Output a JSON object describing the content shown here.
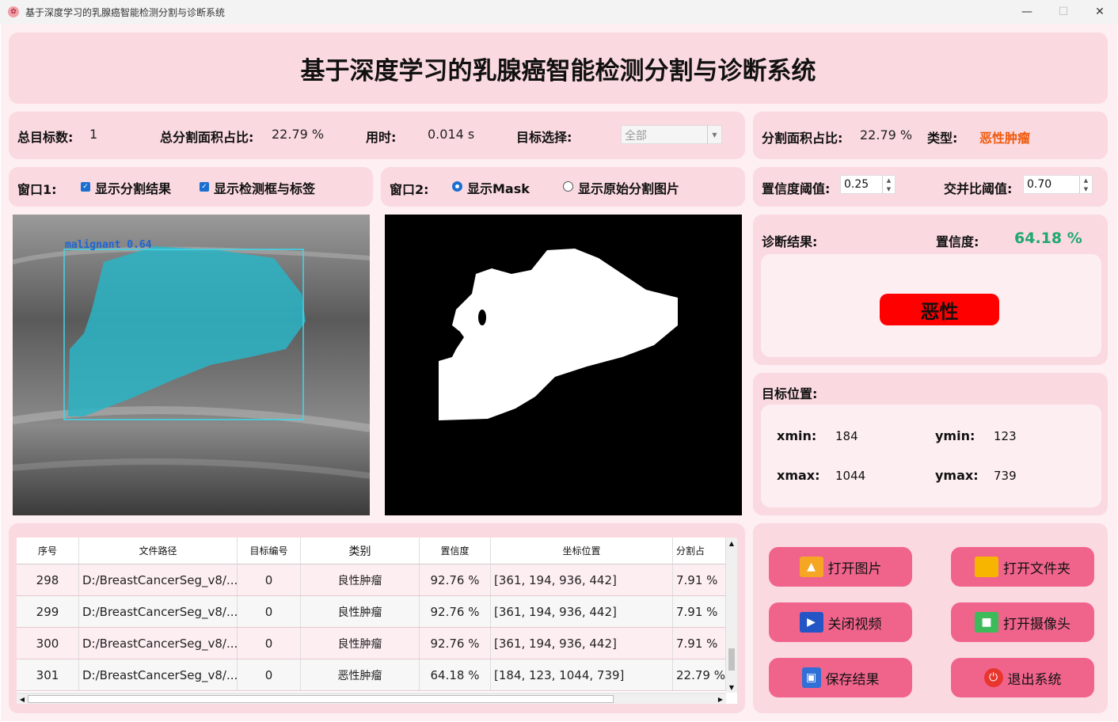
{
  "window": {
    "title": "基于深度学习的乳腺癌智能检测分割与诊断系统",
    "minimize": "—",
    "maximize": "☐",
    "close": "✕"
  },
  "header": {
    "title": "基于深度学习的乳腺癌智能检测分割与诊断系统"
  },
  "stats": {
    "total_label": "总目标数:",
    "total_value": "1",
    "area_label": "总分割面积占比:",
    "area_value": "22.79 %",
    "time_label": "用时:",
    "time_value": "0.014 s",
    "target_label": "目标选择:",
    "target_value": "全部"
  },
  "segment": {
    "area_label": "分割面积占比:",
    "area_value": "22.79 %",
    "type_label": "类型:",
    "type_value": "恶性肿瘤"
  },
  "window1": {
    "label": "窗口1:",
    "opt1": "显示分割结果",
    "opt2": "显示检测框与标签",
    "opt1_checked": true,
    "opt2_checked": true
  },
  "window2": {
    "label": "窗口2:",
    "opt1": "显示Mask",
    "opt2": "显示原始分割图片",
    "selected": "显示Mask"
  },
  "thresholds": {
    "conf_label": "置信度阈值:",
    "conf_value": "0.25",
    "iou_label": "交并比阈值:",
    "iou_value": "0.70"
  },
  "image1": {
    "detection_label": "malignant  0.64"
  },
  "diagnosis": {
    "label": "诊断结果:",
    "conf_label": "置信度:",
    "conf_value": "64.18 %",
    "result": "恶性"
  },
  "position": {
    "label": "目标位置:",
    "xmin_label": "xmin:",
    "xmin": "184",
    "ymin_label": "ymin:",
    "ymin": "123",
    "xmax_label": "xmax:",
    "xmax": "1044",
    "ymax_label": "ymax:",
    "ymax": "739"
  },
  "table": {
    "headers": [
      "序号",
      "文件路径",
      "目标编号",
      "类别",
      "置信度",
      "坐标位置",
      "分割占"
    ],
    "rows": [
      [
        "298",
        "D:/BreastCancerSeg_v8/...",
        "0",
        "良性肿瘤",
        "92.76 %",
        "[361, 194, 936, 442]",
        "7.91 %"
      ],
      [
        "299",
        "D:/BreastCancerSeg_v8/...",
        "0",
        "良性肿瘤",
        "92.76 %",
        "[361, 194, 936, 442]",
        "7.91 %"
      ],
      [
        "300",
        "D:/BreastCancerSeg_v8/...",
        "0",
        "良性肿瘤",
        "92.76 %",
        "[361, 194, 936, 442]",
        "7.91 %"
      ],
      [
        "301",
        "D:/BreastCancerSeg_v8/...",
        "0",
        "恶性肿瘤",
        "64.18 %",
        "[184, 123, 1044, 739]",
        "22.79 %"
      ]
    ]
  },
  "buttons": {
    "open_image": "打开图片",
    "open_folder": "打开文件夹",
    "close_video": "关闭视频",
    "open_camera": "打开摄像头",
    "save": "保存结果",
    "exit": "退出系统"
  },
  "colors": {
    "panel": "#fbd9e1",
    "button": "#f0648c",
    "type_value": "#ef5a0c",
    "conf_value": "#1fa870",
    "badge": "#ff0000"
  }
}
